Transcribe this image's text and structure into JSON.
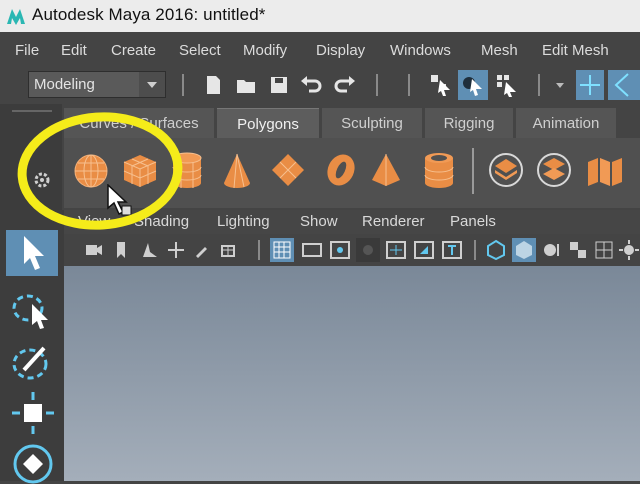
{
  "window": {
    "title": "Autodesk Maya 2016: untitled*"
  },
  "menubar": {
    "items": [
      "File",
      "Edit",
      "Create",
      "Select",
      "Modify",
      "Display",
      "Windows",
      "Mesh",
      "Edit Mesh"
    ]
  },
  "toolbar": {
    "mode": "Modeling"
  },
  "shelf": {
    "tabs": [
      "Curves / Surfaces",
      "Polygons",
      "Sculpting",
      "Rigging",
      "Animation"
    ],
    "active_tab": "Polygons",
    "icons": [
      "poly-sphere",
      "poly-cube",
      "poly-cylinder",
      "poly-cone",
      "poly-plane",
      "poly-torus",
      "poly-pyramid",
      "poly-pipe",
      "combine",
      "separate",
      "extract"
    ]
  },
  "panel": {
    "menu": [
      "View",
      "Shading",
      "Lighting",
      "Show",
      "Renderer",
      "Panels"
    ]
  },
  "toolbox": {
    "tools": [
      "select-tool",
      "lasso-tool",
      "paint-select-tool",
      "move-tool",
      "rotate-tool"
    ]
  },
  "colors": {
    "accent": "#e98d45",
    "annotation": "#f5ec1a",
    "highlight": "#5f8fb4",
    "viewport_top": "#7a8898",
    "viewport_bottom": "#a4aeba"
  }
}
